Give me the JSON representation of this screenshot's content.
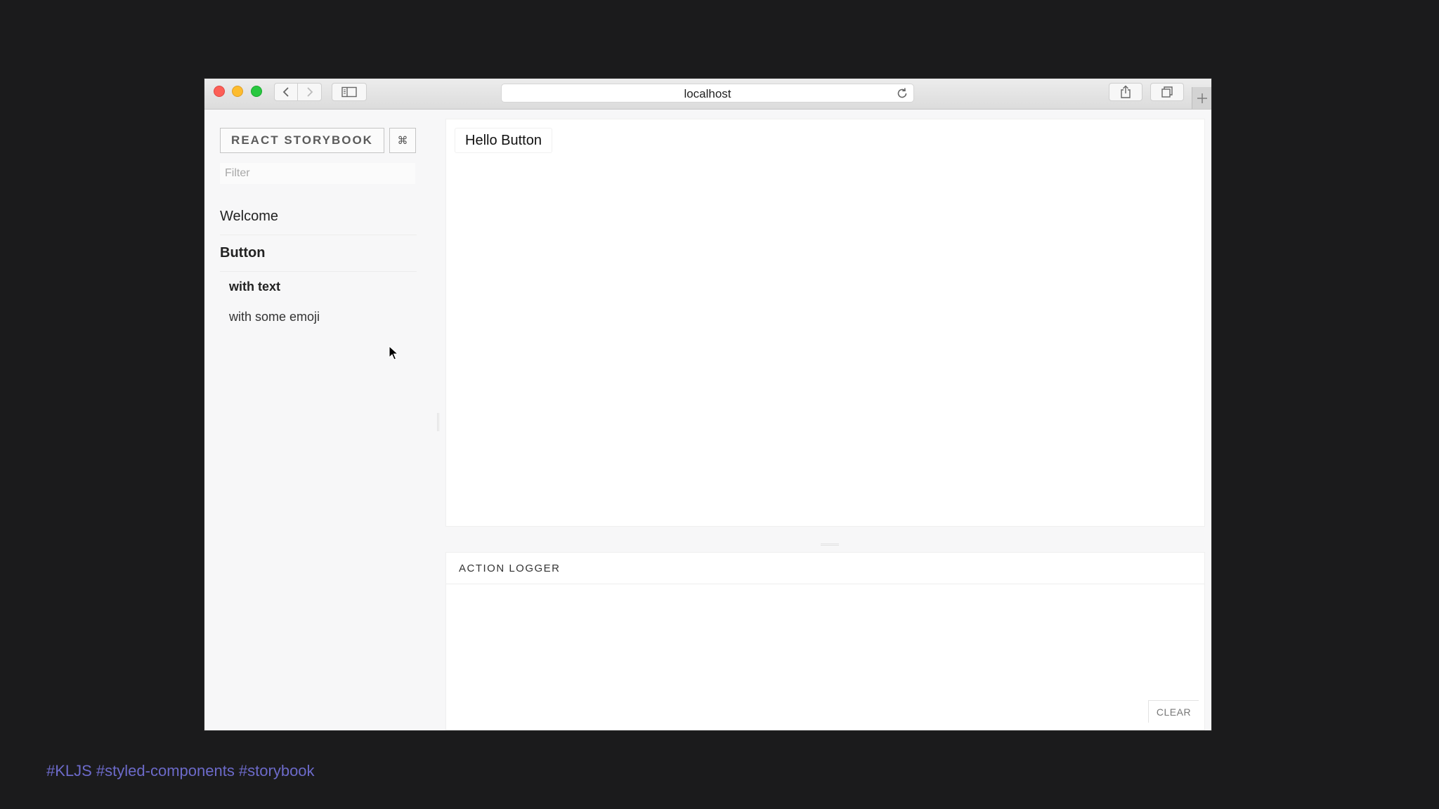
{
  "browser": {
    "address": "localhost",
    "icons": {
      "back": "chevron-left-icon",
      "forward": "chevron-right-icon",
      "sidebar": "sidebar-icon",
      "reload": "reload-icon",
      "share": "share-icon",
      "tabs": "tabs-icon",
      "new_tab": "plus-icon"
    },
    "colors": {
      "close": "#fc5f57",
      "minimize": "#fdbc2e",
      "maximize": "#28c840"
    }
  },
  "storybook": {
    "brand_label": "REACT STORYBOOK",
    "shortcut_label": "⌘",
    "filter_placeholder": "Filter",
    "kinds": [
      {
        "label": "Welcome"
      },
      {
        "label": "Button"
      }
    ],
    "stories": [
      {
        "label": "with text",
        "selected": true
      },
      {
        "label": "with some emoji",
        "selected": false
      }
    ],
    "preview": {
      "button_label": "Hello Button"
    },
    "addon": {
      "tab_label": "ACTION LOGGER",
      "clear_label": "CLEAR"
    }
  },
  "slide": {
    "hashtags": "#KLJS #styled-components #storybook",
    "hashtag_color": "#6c6ac9"
  }
}
